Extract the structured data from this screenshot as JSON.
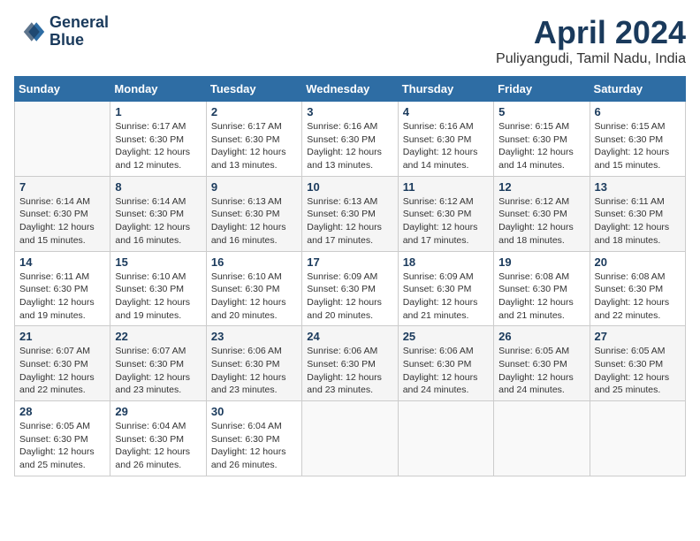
{
  "header": {
    "logo_line1": "General",
    "logo_line2": "Blue",
    "title": "April 2024",
    "location": "Puliyangudi, Tamil Nadu, India"
  },
  "weekdays": [
    "Sunday",
    "Monday",
    "Tuesday",
    "Wednesday",
    "Thursday",
    "Friday",
    "Saturday"
  ],
  "weeks": [
    [
      {
        "day": "",
        "sunrise": "",
        "sunset": "",
        "daylight": ""
      },
      {
        "day": "1",
        "sunrise": "Sunrise: 6:17 AM",
        "sunset": "Sunset: 6:30 PM",
        "daylight": "Daylight: 12 hours and 12 minutes."
      },
      {
        "day": "2",
        "sunrise": "Sunrise: 6:17 AM",
        "sunset": "Sunset: 6:30 PM",
        "daylight": "Daylight: 12 hours and 13 minutes."
      },
      {
        "day": "3",
        "sunrise": "Sunrise: 6:16 AM",
        "sunset": "Sunset: 6:30 PM",
        "daylight": "Daylight: 12 hours and 13 minutes."
      },
      {
        "day": "4",
        "sunrise": "Sunrise: 6:16 AM",
        "sunset": "Sunset: 6:30 PM",
        "daylight": "Daylight: 12 hours and 14 minutes."
      },
      {
        "day": "5",
        "sunrise": "Sunrise: 6:15 AM",
        "sunset": "Sunset: 6:30 PM",
        "daylight": "Daylight: 12 hours and 14 minutes."
      },
      {
        "day": "6",
        "sunrise": "Sunrise: 6:15 AM",
        "sunset": "Sunset: 6:30 PM",
        "daylight": "Daylight: 12 hours and 15 minutes."
      }
    ],
    [
      {
        "day": "7",
        "sunrise": "Sunrise: 6:14 AM",
        "sunset": "Sunset: 6:30 PM",
        "daylight": "Daylight: 12 hours and 15 minutes."
      },
      {
        "day": "8",
        "sunrise": "Sunrise: 6:14 AM",
        "sunset": "Sunset: 6:30 PM",
        "daylight": "Daylight: 12 hours and 16 minutes."
      },
      {
        "day": "9",
        "sunrise": "Sunrise: 6:13 AM",
        "sunset": "Sunset: 6:30 PM",
        "daylight": "Daylight: 12 hours and 16 minutes."
      },
      {
        "day": "10",
        "sunrise": "Sunrise: 6:13 AM",
        "sunset": "Sunset: 6:30 PM",
        "daylight": "Daylight: 12 hours and 17 minutes."
      },
      {
        "day": "11",
        "sunrise": "Sunrise: 6:12 AM",
        "sunset": "Sunset: 6:30 PM",
        "daylight": "Daylight: 12 hours and 17 minutes."
      },
      {
        "day": "12",
        "sunrise": "Sunrise: 6:12 AM",
        "sunset": "Sunset: 6:30 PM",
        "daylight": "Daylight: 12 hours and 18 minutes."
      },
      {
        "day": "13",
        "sunrise": "Sunrise: 6:11 AM",
        "sunset": "Sunset: 6:30 PM",
        "daylight": "Daylight: 12 hours and 18 minutes."
      }
    ],
    [
      {
        "day": "14",
        "sunrise": "Sunrise: 6:11 AM",
        "sunset": "Sunset: 6:30 PM",
        "daylight": "Daylight: 12 hours and 19 minutes."
      },
      {
        "day": "15",
        "sunrise": "Sunrise: 6:10 AM",
        "sunset": "Sunset: 6:30 PM",
        "daylight": "Daylight: 12 hours and 19 minutes."
      },
      {
        "day": "16",
        "sunrise": "Sunrise: 6:10 AM",
        "sunset": "Sunset: 6:30 PM",
        "daylight": "Daylight: 12 hours and 20 minutes."
      },
      {
        "day": "17",
        "sunrise": "Sunrise: 6:09 AM",
        "sunset": "Sunset: 6:30 PM",
        "daylight": "Daylight: 12 hours and 20 minutes."
      },
      {
        "day": "18",
        "sunrise": "Sunrise: 6:09 AM",
        "sunset": "Sunset: 6:30 PM",
        "daylight": "Daylight: 12 hours and 21 minutes."
      },
      {
        "day": "19",
        "sunrise": "Sunrise: 6:08 AM",
        "sunset": "Sunset: 6:30 PM",
        "daylight": "Daylight: 12 hours and 21 minutes."
      },
      {
        "day": "20",
        "sunrise": "Sunrise: 6:08 AM",
        "sunset": "Sunset: 6:30 PM",
        "daylight": "Daylight: 12 hours and 22 minutes."
      }
    ],
    [
      {
        "day": "21",
        "sunrise": "Sunrise: 6:07 AM",
        "sunset": "Sunset: 6:30 PM",
        "daylight": "Daylight: 12 hours and 22 minutes."
      },
      {
        "day": "22",
        "sunrise": "Sunrise: 6:07 AM",
        "sunset": "Sunset: 6:30 PM",
        "daylight": "Daylight: 12 hours and 23 minutes."
      },
      {
        "day": "23",
        "sunrise": "Sunrise: 6:06 AM",
        "sunset": "Sunset: 6:30 PM",
        "daylight": "Daylight: 12 hours and 23 minutes."
      },
      {
        "day": "24",
        "sunrise": "Sunrise: 6:06 AM",
        "sunset": "Sunset: 6:30 PM",
        "daylight": "Daylight: 12 hours and 23 minutes."
      },
      {
        "day": "25",
        "sunrise": "Sunrise: 6:06 AM",
        "sunset": "Sunset: 6:30 PM",
        "daylight": "Daylight: 12 hours and 24 minutes."
      },
      {
        "day": "26",
        "sunrise": "Sunrise: 6:05 AM",
        "sunset": "Sunset: 6:30 PM",
        "daylight": "Daylight: 12 hours and 24 minutes."
      },
      {
        "day": "27",
        "sunrise": "Sunrise: 6:05 AM",
        "sunset": "Sunset: 6:30 PM",
        "daylight": "Daylight: 12 hours and 25 minutes."
      }
    ],
    [
      {
        "day": "28",
        "sunrise": "Sunrise: 6:05 AM",
        "sunset": "Sunset: 6:30 PM",
        "daylight": "Daylight: 12 hours and 25 minutes."
      },
      {
        "day": "29",
        "sunrise": "Sunrise: 6:04 AM",
        "sunset": "Sunset: 6:30 PM",
        "daylight": "Daylight: 12 hours and 26 minutes."
      },
      {
        "day": "30",
        "sunrise": "Sunrise: 6:04 AM",
        "sunset": "Sunset: 6:30 PM",
        "daylight": "Daylight: 12 hours and 26 minutes."
      },
      {
        "day": "",
        "sunrise": "",
        "sunset": "",
        "daylight": ""
      },
      {
        "day": "",
        "sunrise": "",
        "sunset": "",
        "daylight": ""
      },
      {
        "day": "",
        "sunrise": "",
        "sunset": "",
        "daylight": ""
      },
      {
        "day": "",
        "sunrise": "",
        "sunset": "",
        "daylight": ""
      }
    ]
  ]
}
